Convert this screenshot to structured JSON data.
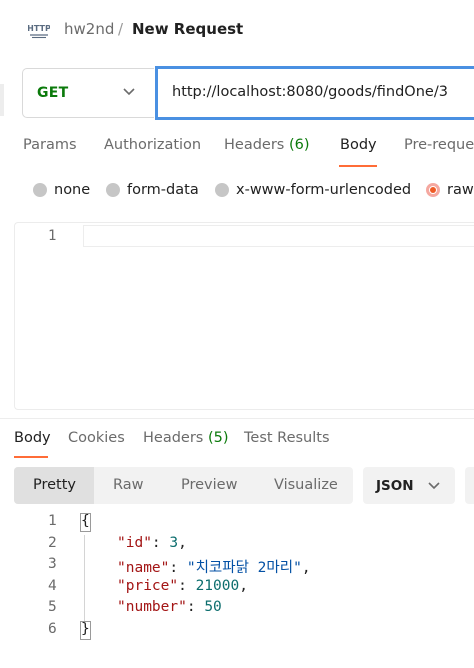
{
  "header": {
    "collection": "hw2nd",
    "separator": "/",
    "request_name": "New Request",
    "icon": "http-icon"
  },
  "request": {
    "method": "GET",
    "url": "http://localhost:8080/goods/findOne/3"
  },
  "request_tabs": [
    {
      "label": "Params"
    },
    {
      "label": "Authorization"
    },
    {
      "label": "Headers",
      "count": "(6)"
    },
    {
      "label": "Body",
      "active": true
    },
    {
      "label": "Pre-reque"
    }
  ],
  "body_types": [
    {
      "label": "none",
      "checked": false
    },
    {
      "label": "form-data",
      "checked": false
    },
    {
      "label": "x-www-form-urlencoded",
      "checked": false
    },
    {
      "label": "raw",
      "checked": true
    }
  ],
  "request_editor": {
    "line_numbers": [
      "1"
    ]
  },
  "response_tabs": [
    {
      "label": "Body",
      "active": true
    },
    {
      "label": "Cookies"
    },
    {
      "label": "Headers",
      "count": "(5)"
    },
    {
      "label": "Test Results"
    }
  ],
  "view_modes": [
    {
      "label": "Pretty",
      "active": true
    },
    {
      "label": "Raw"
    },
    {
      "label": "Preview"
    },
    {
      "label": "Visualize"
    }
  ],
  "format": {
    "selected": "JSON"
  },
  "response_body": {
    "line_numbers": [
      "1",
      "2",
      "3",
      "4",
      "5",
      "6"
    ],
    "open_brace": "{",
    "close_brace": "}",
    "fields": [
      {
        "key": "\"id\"",
        "value": "3",
        "type": "number",
        "trailing": ","
      },
      {
        "key": "\"name\"",
        "value": "\"치코파닭 2마리\"",
        "type": "string",
        "trailing": ","
      },
      {
        "key": "\"price\"",
        "value": "21000",
        "type": "number",
        "trailing": ","
      },
      {
        "key": "\"number\"",
        "value": "50",
        "type": "number",
        "trailing": ""
      }
    ]
  },
  "colors": {
    "accent": "#ff6c37",
    "method_get": "#0b7a0b",
    "url_focus": "#4a90e2",
    "json_key": "#a31515",
    "json_number": "#0d6e6e",
    "json_string": "#0451a5"
  }
}
